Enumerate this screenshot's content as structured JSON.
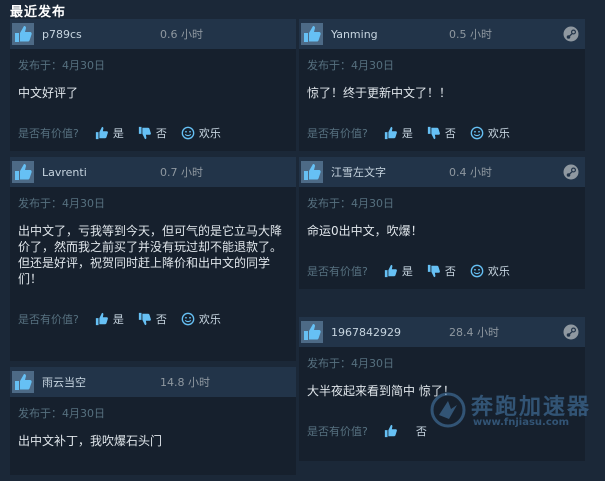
{
  "section_title": "最近发布",
  "labels": {
    "helpful_question": "是否有价值?",
    "yes": "是",
    "no": "否",
    "funny": "欢乐"
  },
  "reviews_left": [
    {
      "user": "p789cs",
      "hours": "0.6 小时",
      "posted": "发布于：4月30日",
      "text": "中文好评了"
    },
    {
      "user": "Lavrenti",
      "hours": "0.7 小时",
      "posted": "发布于：4月30日",
      "text": "出中文了，亏我等到今天，但可气的是它立马大降价了，然而我之前买了并没有玩过却不能退款了。\n但还是好评，祝贺同时赶上降价和出中文的同学们！"
    },
    {
      "user": "雨云当空",
      "hours": "14.8 小时",
      "posted": "发布于：4月30日",
      "text": "出中文补丁，我吹爆石头门"
    }
  ],
  "reviews_right": [
    {
      "user": "Yanming",
      "hours": "0.5 小时",
      "posted": "发布于：4月30日",
      "text": "惊了！终于更新中文了！！"
    },
    {
      "user": "江雪左文字",
      "hours": "0.4 小时",
      "posted": "发布于：4月30日",
      "text": "命运0出中文，吹爆！"
    },
    {
      "user": "1967842929",
      "hours": "28.4 小时",
      "posted": "发布于：4月30日",
      "text": "大半夜起来看到简中 惊了！"
    }
  ],
  "watermark": {
    "title": "奔跑加速器",
    "url": "www.fnjiasu.com"
  },
  "colors": {
    "background": "#1b2838",
    "card_header": "#223449",
    "card_body": "#16202d",
    "thumb_box": "#4d6a86"
  }
}
